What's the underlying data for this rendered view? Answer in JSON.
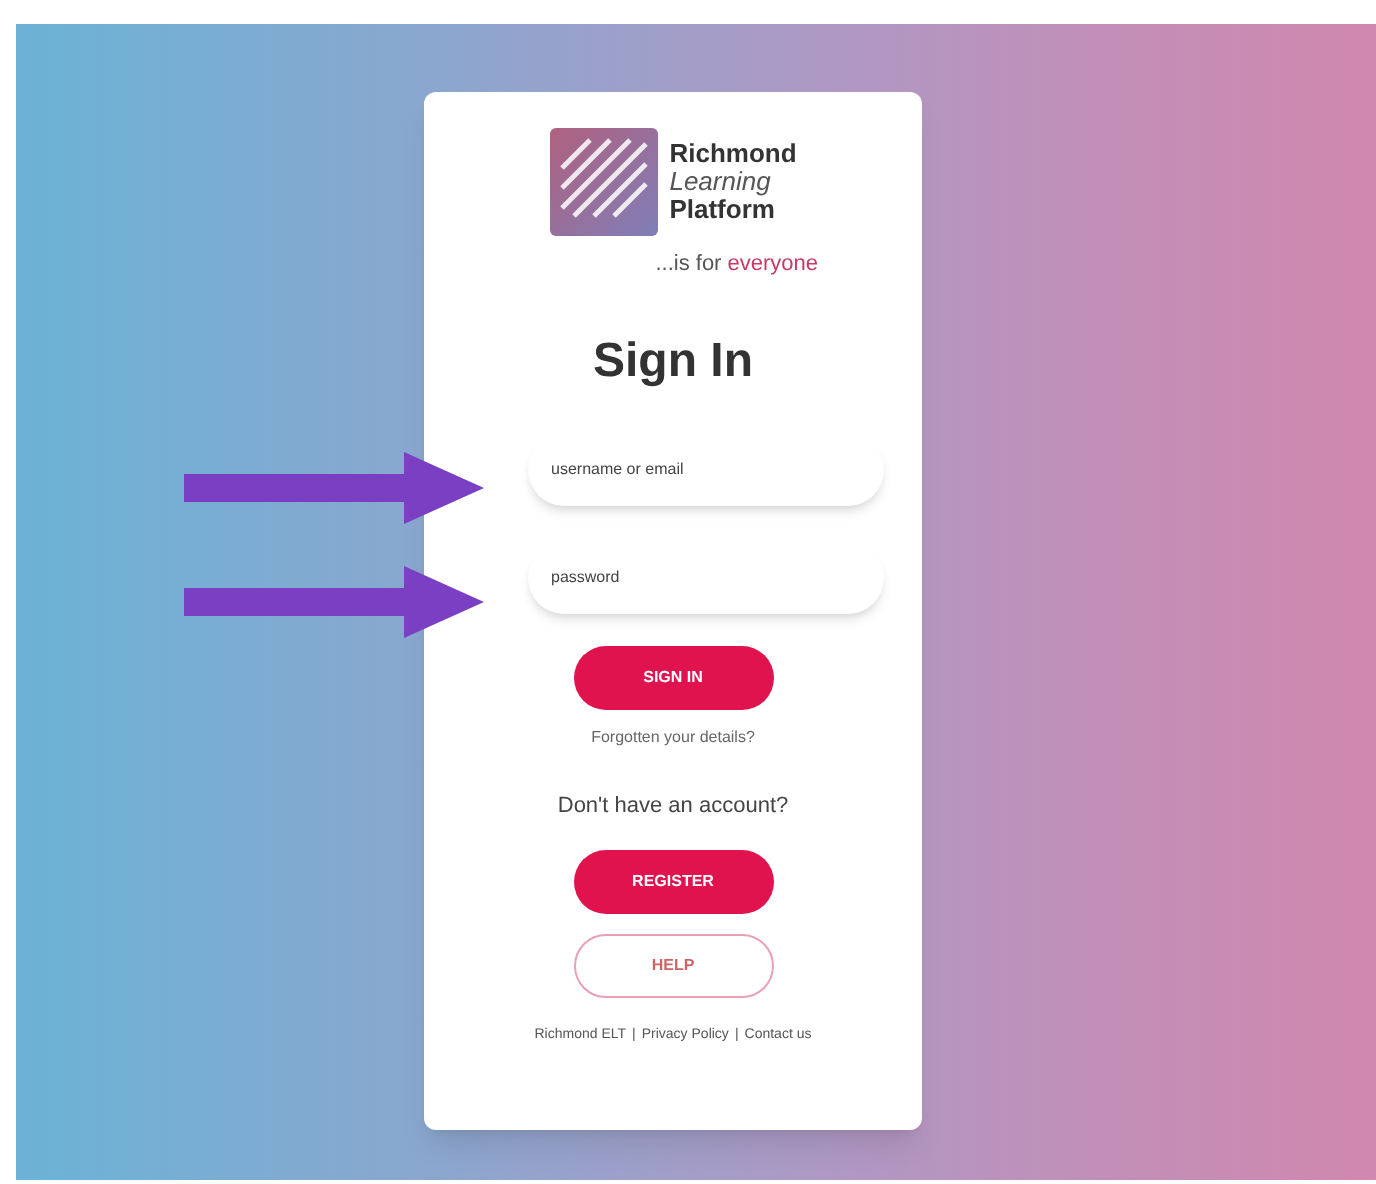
{
  "logo": {
    "line_1": "Richmond",
    "line_2": "Learning",
    "line_3": "Platform"
  },
  "tagline": {
    "lead": "...is for",
    "highlight": "everyone"
  },
  "heading": "Sign In",
  "fields": [
    {
      "placeholder": "username or email"
    },
    {
      "placeholder": "password"
    }
  ],
  "sign_in_button": "SIGN IN",
  "help_link": "Forgotten your details?",
  "register_prompt": "Don't have an account?",
  "register_button": "REGISTER",
  "help_button": "HELP",
  "footer_links": [
    "Richmond ELT",
    "Privacy Policy",
    "Contact us"
  ],
  "footer_separator": "|"
}
